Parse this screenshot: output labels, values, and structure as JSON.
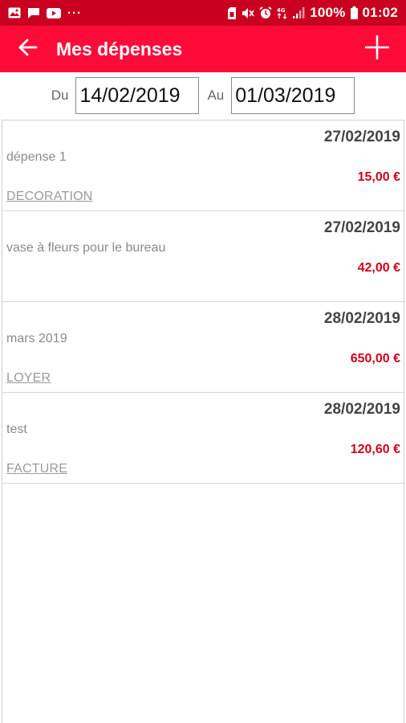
{
  "status_bar": {
    "battery_text": "100%",
    "time": "01:02",
    "left_icons": [
      "image-icon",
      "message-icon",
      "youtube-icon",
      "more-dots-icon"
    ],
    "right_icons": [
      "sim-icon",
      "mute-icon",
      "alarm-icon",
      "data-icon",
      "signal-icon",
      "battery-icon"
    ],
    "more_dots": "···"
  },
  "app_bar": {
    "title": "Mes dépenses",
    "back_icon": "arrow-left-icon",
    "add_icon": "plus-icon"
  },
  "filter": {
    "from_label": "Du",
    "from_value": "14/02/2019",
    "to_label": "Au",
    "to_value": "01/03/2019"
  },
  "expenses": [
    {
      "date": "27/02/2019",
      "description": "dépense 1",
      "amount": "15,00 €",
      "category": "DECORATION"
    },
    {
      "date": "27/02/2019",
      "description": "vase à fleurs pour le bureau",
      "amount": "42,00 €",
      "category": ""
    },
    {
      "date": "28/02/2019",
      "description": "mars 2019",
      "amount": "650,00 €",
      "category": "LOYER"
    },
    {
      "date": "28/02/2019",
      "description": "test",
      "amount": "120,60 €",
      "category": "FACTURE"
    }
  ],
  "colors": {
    "status_bar": "#c9001f",
    "app_bar": "#ff0b3a",
    "amount": "#d0021b"
  }
}
